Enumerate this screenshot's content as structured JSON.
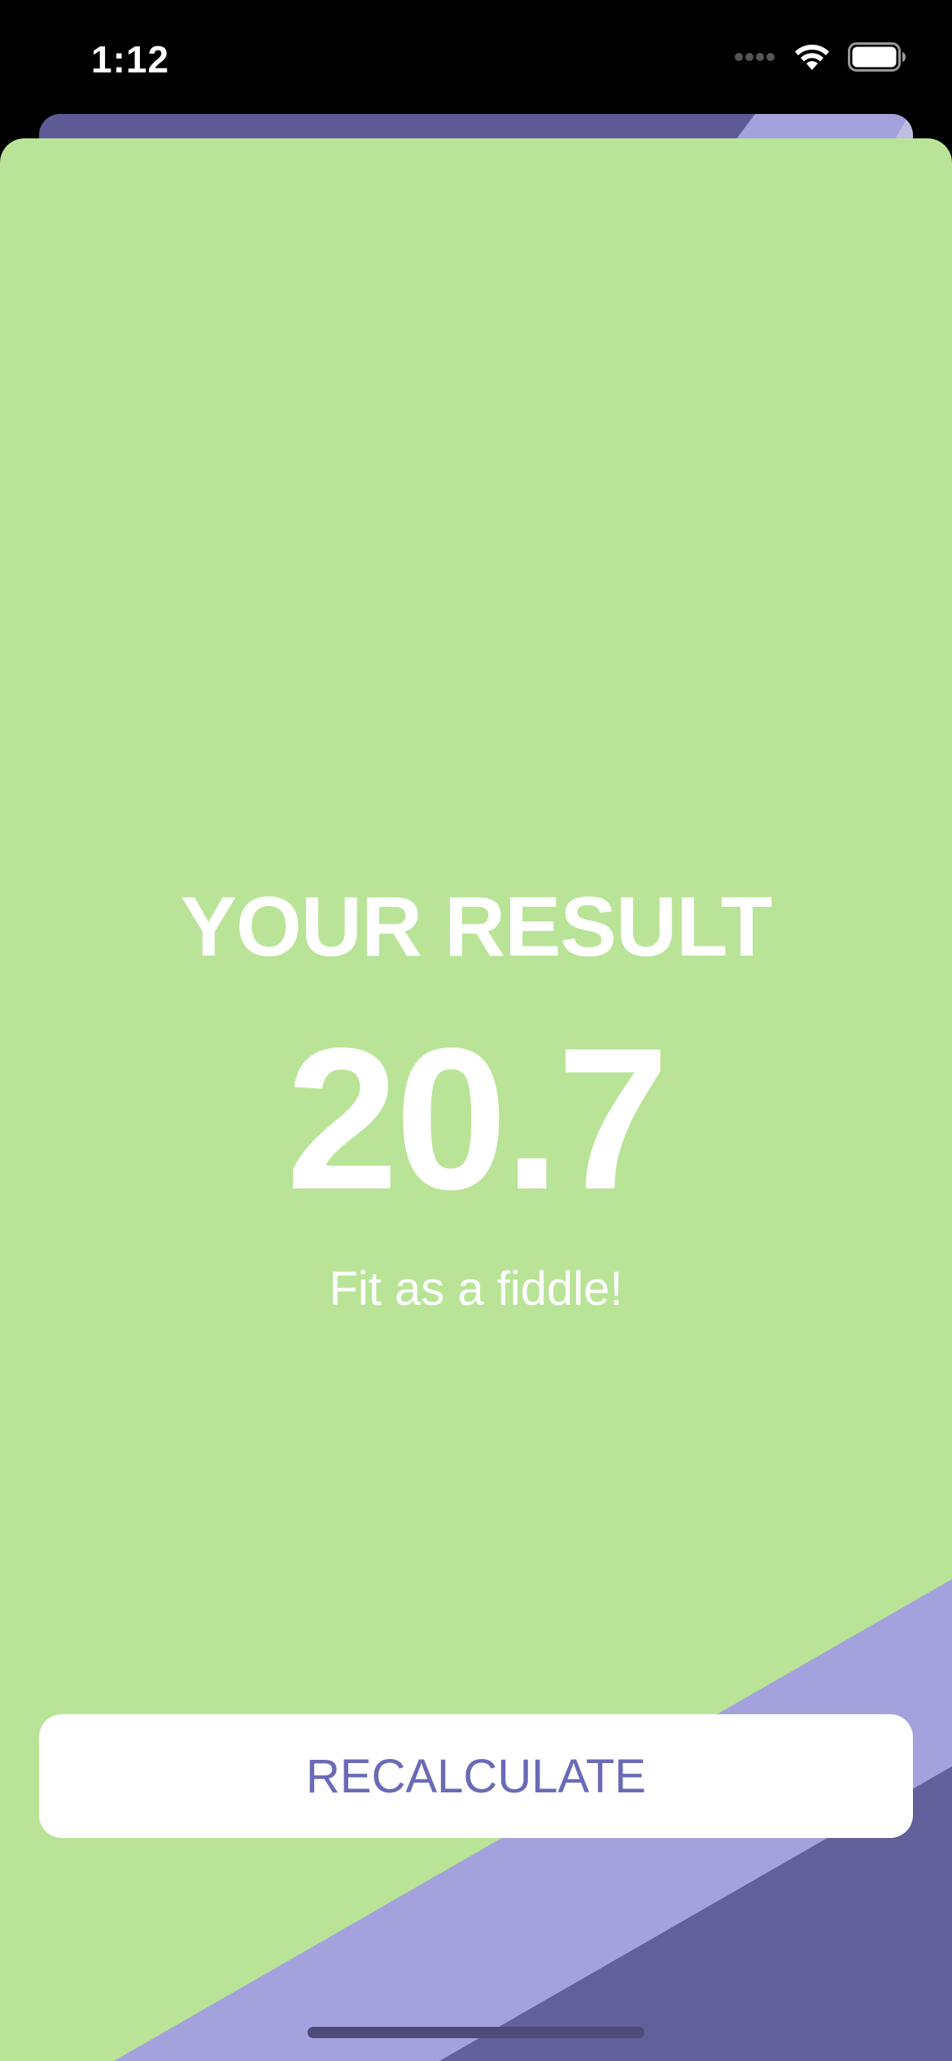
{
  "status_bar": {
    "time": "1:12",
    "icons": [
      "signal-dots-icon",
      "wifi-icon",
      "battery-icon"
    ]
  },
  "result": {
    "title": "YOUR RESULT",
    "value": "20.7",
    "advice": "Fit as a fiddle!"
  },
  "actions": {
    "recalculate_label": "RECALCULATE"
  },
  "colors": {
    "sheet_background": "#b9e497",
    "stripe_light": "#a3a2dc",
    "stripe_dark": "#62609a",
    "button_text": "#6b6ab6",
    "text": "#ffffff"
  }
}
